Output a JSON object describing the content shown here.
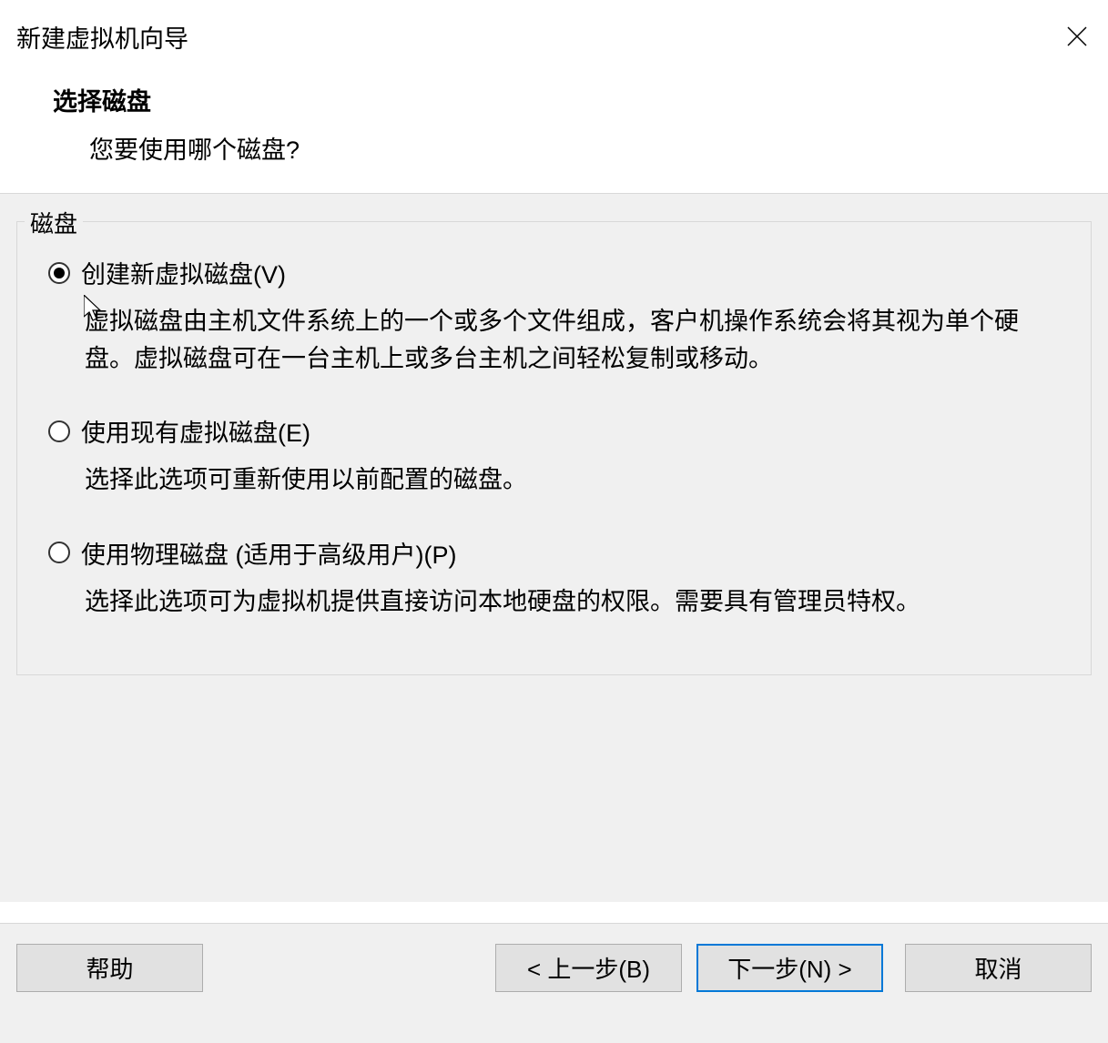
{
  "titlebar": {
    "title": "新建虚拟机向导"
  },
  "header": {
    "title": "选择磁盘",
    "subtitle": "您要使用哪个磁盘?"
  },
  "fieldset": {
    "legend": "磁盘"
  },
  "options": [
    {
      "label": "创建新虚拟磁盘(V)",
      "desc": "虚拟磁盘由主机文件系统上的一个或多个文件组成，客户机操作系统会将其视为单个硬盘。虚拟磁盘可在一台主机上或多台主机之间轻松复制或移动。",
      "checked": true
    },
    {
      "label": "使用现有虚拟磁盘(E)",
      "desc": "选择此选项可重新使用以前配置的磁盘。",
      "checked": false
    },
    {
      "label": "使用物理磁盘 (适用于高级用户)(P)",
      "desc": "选择此选项可为虚拟机提供直接访问本地硬盘的权限。需要具有管理员特权。",
      "checked": false
    }
  ],
  "footer": {
    "help": "帮助",
    "back": "< 上一步(B)",
    "next": "下一步(N) >",
    "cancel": "取消"
  }
}
